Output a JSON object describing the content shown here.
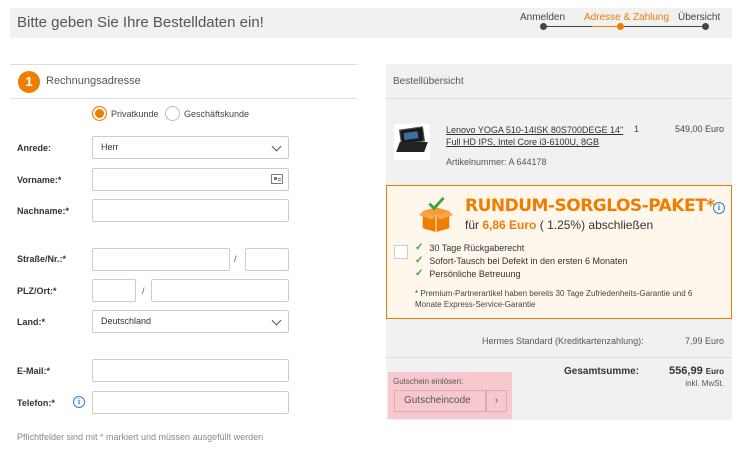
{
  "header": {
    "title": "Bitte geben Sie Ihre Bestelldaten ein!",
    "steps": [
      {
        "label": "Anmelden",
        "active": false
      },
      {
        "label": "Adresse & Zahlung",
        "active": true
      },
      {
        "label": "Übersicht",
        "active": false
      }
    ]
  },
  "colors": {
    "accent": "#f07d00",
    "info": "#2d7dd2",
    "check": "#3aa53a",
    "voucher_bg": "#f7c9cf"
  },
  "billing": {
    "step_number": "1",
    "title": "Rechnungsadresse",
    "customer_types": [
      {
        "label": "Privatkunde",
        "selected": true
      },
      {
        "label": "Geschäftskunde",
        "selected": false
      }
    ],
    "fields": {
      "salutation": {
        "label": "Anrede:",
        "value": "Herr"
      },
      "firstname": {
        "label": "Vorname:*",
        "value": ""
      },
      "lastname": {
        "label": "Nachname:*",
        "value": ""
      },
      "street": {
        "label": "Straße/Nr.:*",
        "value": "",
        "number": ""
      },
      "zip_city": {
        "label": "PLZ/Ort:*",
        "zip": "",
        "city": ""
      },
      "country": {
        "label": "Land:*",
        "value": "Deutschland"
      },
      "email": {
        "label": "E-Mail:*",
        "value": ""
      },
      "phone": {
        "label": "Telefon:*",
        "value": ""
      }
    },
    "separator": "/",
    "footnote": "Pflichtfelder sind mit * markiert und müssen ausgefüllt werden"
  },
  "summary": {
    "title": "Bestellübersicht",
    "product": {
      "name": "Lenovo YOGA 510-14ISK 80S700DEGE 14\" Full HD IPS, Intel Core i3-6100U, 8GB",
      "qty": "1",
      "price": "549,00 Euro",
      "article": "Artikelnummer: A 644178"
    },
    "promo": {
      "title": "RUNDUM-SORGLOS-PAKET*",
      "sub_prefix": "für",
      "sub_price": "6,86 Euro",
      "sub_suffix": "( 1.25%) abschließen",
      "bullets": [
        "30 Tage Rückgaberecht",
        "Sofort-Tausch bei Defekt in den ersten 6 Monaten",
        "Persönliche Betreuung"
      ],
      "note": "* Premium-Partnerartikel haben bereits 30 Tage Zufriedenheits-Garantie und 6 Monate Express-Service-Garantie"
    },
    "shipping": {
      "label": "Hermes Standard (Kreditkartenzahlung):",
      "value": "7,99 Euro"
    },
    "total": {
      "label": "Gesamtsumme:",
      "amount": "556,99",
      "currency": "Euro",
      "vat": "inkl. MwSt."
    },
    "voucher": {
      "label": "Gutschein einlösen:",
      "placeholder": "Gutscheincode",
      "button": "›"
    }
  }
}
